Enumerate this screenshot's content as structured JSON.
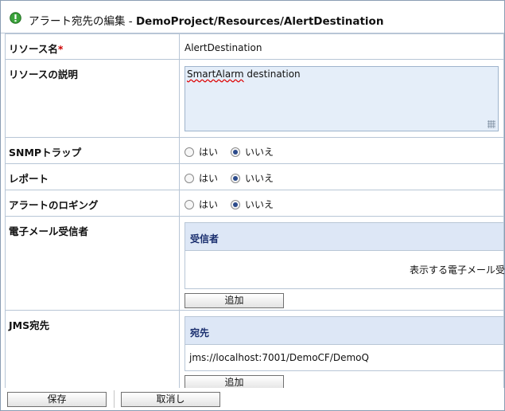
{
  "window": {
    "title_jp": "アラート宛先の編集 - ",
    "title_path": "DemoProject/Resources/AlertDestination"
  },
  "fields": {
    "resource_name": {
      "label": "リソース名",
      "required_mark": "*",
      "value": "AlertDestination"
    },
    "resource_desc": {
      "label": "リソースの説明",
      "value_word1": "SmartAlarm",
      "value_word2": " destination"
    },
    "snmp": {
      "label": "SNMPトラップ",
      "yes": "はい",
      "no": "いいえ",
      "selected": "no"
    },
    "report": {
      "label": "レポート",
      "yes": "はい",
      "no": "いいえ",
      "selected": "no"
    },
    "alert_logging": {
      "label": "アラートのロギング",
      "yes": "はい",
      "no": "いいえ",
      "selected": "no"
    },
    "email": {
      "label": "電子メール受信者",
      "column": "受信者",
      "empty_text": "表示する電子メール受信",
      "add_button": "追加"
    },
    "jms": {
      "label": "JMS宛先",
      "column": "宛先",
      "rows": [
        "jms://localhost:7001/DemoCF/DemoQ"
      ],
      "add_button": "追加"
    }
  },
  "footer": {
    "save": "保存",
    "cancel": "取消し"
  },
  "colors": {
    "accent": "#1a2f6f",
    "header_bg": "#dde7f6",
    "textarea_bg": "#e5eef9",
    "required": "#cc0000",
    "status_icon": "#3aa33a"
  }
}
